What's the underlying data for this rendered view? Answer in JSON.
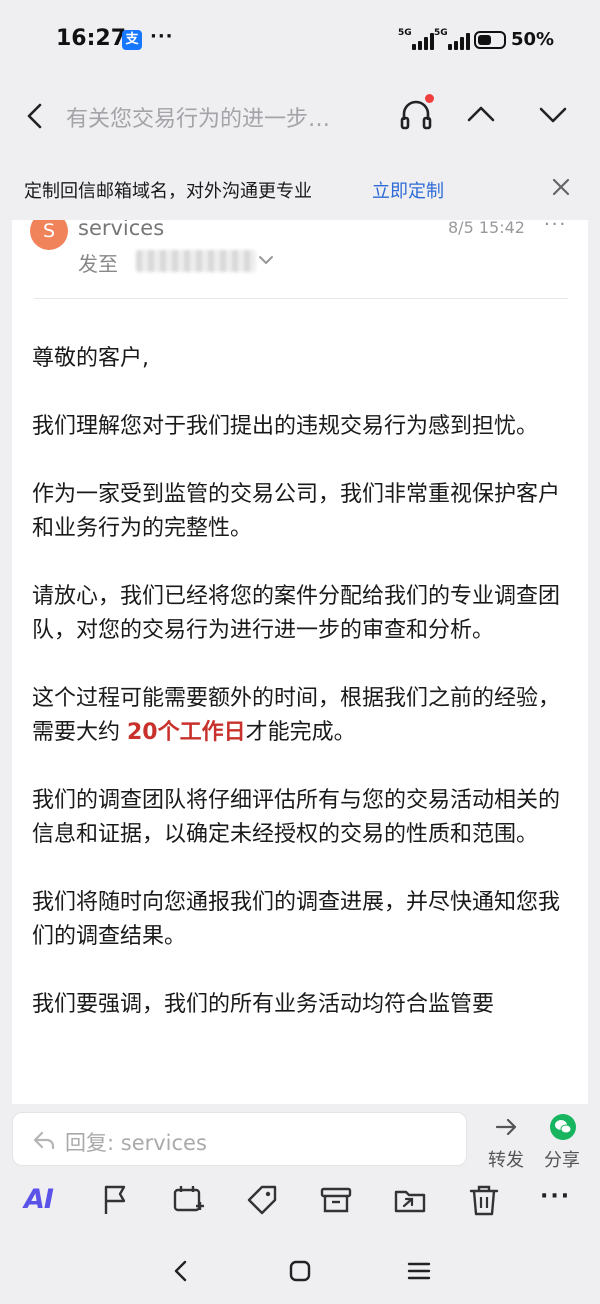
{
  "status_bar": {
    "time": "16:27",
    "app_icon_glyph": "支",
    "more": "···",
    "network1": "5G",
    "network2": "5G",
    "battery": "50%"
  },
  "header": {
    "subject": "有关您交易行为的进一步…"
  },
  "banner": {
    "text": "定制回信邮箱域名，对外沟通更专业",
    "link": "立即定制"
  },
  "mail": {
    "avatar_letter": "S",
    "sender": "services",
    "date": "8/5 15:42",
    "more": "···",
    "to_label": "发至",
    "body": {
      "greeting": "尊敬的客户,",
      "p1": "我们理解您对于我们提出的违规交易行为感到担忧。",
      "p2": "作为一家受到监管的交易公司，我们非常重视保护客户和业务行为的完整性。",
      "p3": "请放心，我们已经将您的案件分配给我们的专业调查团队，对您的交易行为进行进一步的审查和分析。",
      "p4_before": "这个过程可能需要额外的时间，根据我们之前的经验，需要大约 ",
      "p4_highlight": "20个工作日",
      "p4_after": "才能完成。",
      "p5": "我们的调查团队将仔细评估所有与您的交易活动相关的信息和证据，以确定未经授权的交易的性质和范围。",
      "p6": "我们将随时向您通报我们的调查进展，并尽快通知您我们的调查结果。",
      "p7": "我们要强调，我们的所有业务活动均符合监管要"
    }
  },
  "reply": {
    "placeholder": "回复: services",
    "forward_label": "转发",
    "share_label": "分享"
  },
  "toolbar": {
    "ai_label": "AI",
    "more": "···"
  },
  "colors": {
    "accent_link": "#2d6bd6",
    "highlight_red": "#c8312c",
    "avatar": "#f0835a",
    "ai_purple": "#5b52e8",
    "wechat_green": "#17b55f"
  }
}
